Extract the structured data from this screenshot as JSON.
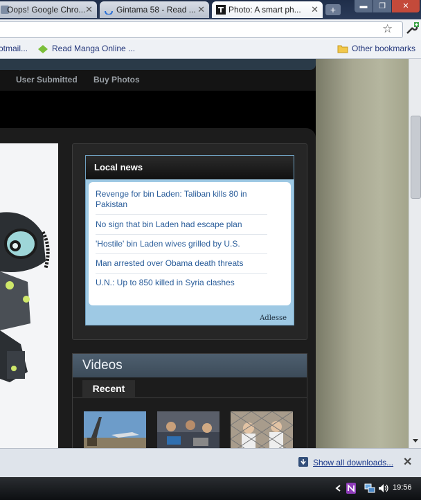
{
  "tabs": [
    {
      "label": "Oops! Google Chro...",
      "close": "✕"
    },
    {
      "label": "Gintama 58 - Read ...",
      "close": "✕"
    },
    {
      "label": "Photo: A smart ph...",
      "close": "✕"
    }
  ],
  "window_controls": {
    "minimize": "▬",
    "restore": "❐",
    "close": "✕"
  },
  "bookmarks": [
    {
      "label": "otmail..."
    },
    {
      "label": "Read Manga Online ..."
    },
    {
      "label": "Other bookmarks"
    }
  ],
  "subnav": {
    "user_submitted": "User Submitted",
    "buy_photos": "Buy Photos"
  },
  "local_news": {
    "heading": "Local news",
    "items": [
      "Revenge for bin Laden: Taliban kills 80 in Pakistan",
      "No sign that bin Laden had escape plan",
      "'Hostile' bin Laden wives grilled by U.S.",
      "Man arrested over Obama death threats",
      "U.N.: Up to 850 killed in Syria clashes"
    ],
    "sponsor": "Adlesse"
  },
  "videos": {
    "heading": "Videos",
    "tab": "Recent"
  },
  "downloads_bar": {
    "show_all": "Show all downloads...",
    "close": "✕"
  },
  "taskbar": {
    "time": "19:56"
  },
  "colors": {
    "link": "#2a5d9a",
    "tab_strip": "#1f2e4a",
    "news_frame": "#9ec9e4"
  }
}
